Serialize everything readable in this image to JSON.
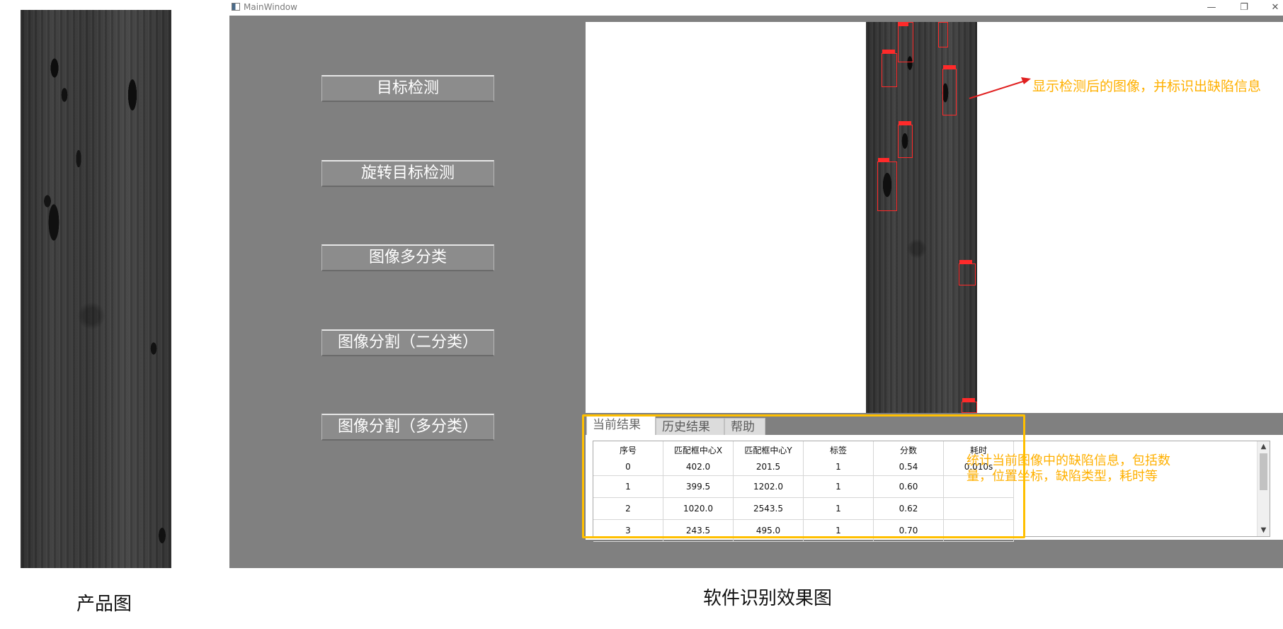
{
  "captions": {
    "product": "产品图",
    "software": "软件识别效果图"
  },
  "window": {
    "title": "MainWindow",
    "minimize_icon": "—",
    "restore_icon": "❐",
    "close_icon": "✕"
  },
  "buttons": {
    "object_detection": "目标检测",
    "rotated_detection": "旋转目标检测",
    "multi_classification": "图像多分类",
    "binary_segmentation": "图像分割（二分类）",
    "multi_segmentation": "图像分割（多分类）"
  },
  "tabs": {
    "current": "当前结果",
    "history": "历史结果",
    "help": "帮助"
  },
  "table": {
    "headers": [
      "序号",
      "匹配框中心X",
      "匹配框中心Y",
      "标签",
      "分数",
      "耗时"
    ],
    "rows": [
      [
        "0",
        "402.0",
        "201.5",
        "1",
        "0.54",
        "0.010s"
      ],
      [
        "1",
        "399.5",
        "1202.0",
        "1",
        "0.60",
        ""
      ],
      [
        "2",
        "1020.0",
        "2543.5",
        "1",
        "0.62",
        ""
      ],
      [
        "3",
        "243.5",
        "495.0",
        "1",
        "0.70",
        ""
      ]
    ]
  },
  "annotations": {
    "image": "显示检测后的图像，并标识出缺陷信息",
    "table": "统计当前图像中的缺陷信息，包括数量，位置坐标，缺陷类型，耗时等"
  },
  "colors": {
    "annotation": "#ffb000",
    "highlight": "#ffbf00",
    "detection_box": "#ff2a2a",
    "window_bg": "#808080"
  },
  "icons": {
    "app": "app-window-icon",
    "scroll_up": "▲",
    "scroll_down": "▼"
  }
}
